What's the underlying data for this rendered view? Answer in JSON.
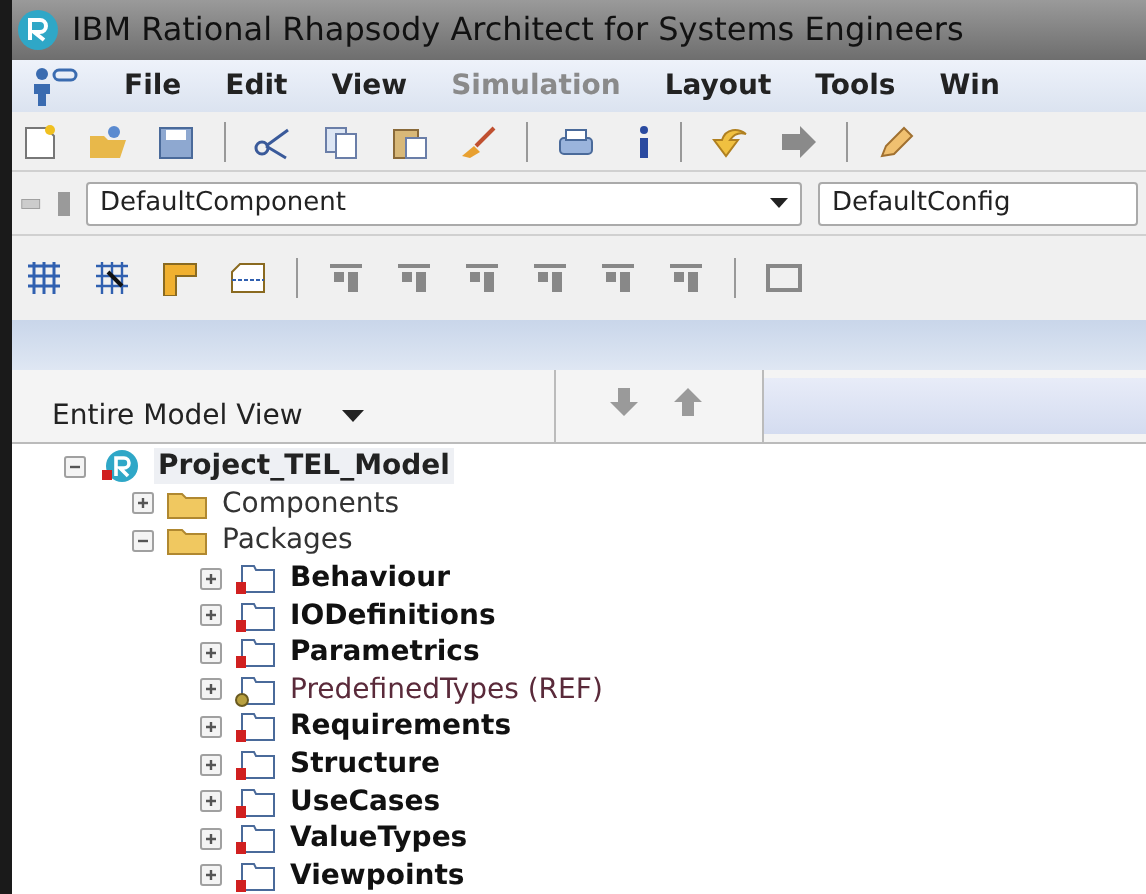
{
  "window": {
    "title": "IBM Rational Rhapsody Architect for Systems Engineers"
  },
  "menu": [
    {
      "label": "File",
      "disabled": false
    },
    {
      "label": "Edit",
      "disabled": false
    },
    {
      "label": "View",
      "disabled": false
    },
    {
      "label": "Simulation",
      "disabled": true
    },
    {
      "label": "Layout",
      "disabled": false
    },
    {
      "label": "Tools",
      "disabled": false
    },
    {
      "label": "Win",
      "disabled": false
    }
  ],
  "toolbar": {
    "component": "DefaultComponent",
    "configuration": "DefaultConfig"
  },
  "browser": {
    "view": "Entire Model View"
  },
  "tree": [
    {
      "label": "Project_TEL_Model",
      "kind": "project",
      "expanded": true,
      "children": [
        {
          "label": "Components",
          "kind": "folder",
          "expanded": false
        },
        {
          "label": "Packages",
          "kind": "folder",
          "expanded": true,
          "children": [
            {
              "label": "Behaviour",
              "kind": "package",
              "expanded": false
            },
            {
              "label": "IODefinitions",
              "kind": "package",
              "expanded": false
            },
            {
              "label": "Parametrics",
              "kind": "package",
              "expanded": false
            },
            {
              "label": "PredefinedTypes (REF)",
              "kind": "reference",
              "expanded": false
            },
            {
              "label": "Requirements",
              "kind": "package",
              "expanded": false
            },
            {
              "label": "Structure",
              "kind": "package",
              "expanded": false
            },
            {
              "label": "UseCases",
              "kind": "package",
              "expanded": false
            },
            {
              "label": "ValueTypes",
              "kind": "package",
              "expanded": false
            },
            {
              "label": "Viewpoints",
              "kind": "package",
              "expanded": false
            }
          ]
        }
      ]
    }
  ]
}
